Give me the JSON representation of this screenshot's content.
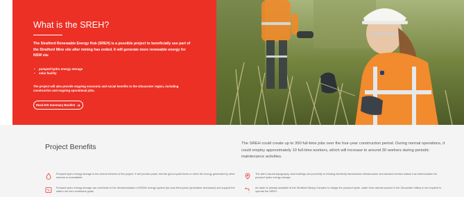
{
  "hero": {
    "title": "What is the SREH?",
    "intro": "The Stratford Renewable Energy Hub (SREH) is a possible project to beneficially use part of the Stratford Mine site after mining has ended. It will generate more renewable energy for NSW via:",
    "list": [
      "pumped hydro energy storage",
      "solar facility"
    ],
    "extra": "The project will also provide ongoing economic and social benefits to the Gloucester region, including construction and ongoing operational jobs.",
    "cta_label": "Read EIS Summary Booklet",
    "cta_icon": "arrow-right-icon",
    "accent_color": "#ec3025"
  },
  "benefits": {
    "title": "Project Benefits",
    "description": "The SREH could create up to 350 full-time jobs over the four-year construction period. During normal operations, it could employ approximately 10 full-time workers, which will increase to around 30 workers during periodic maintenance activities.",
    "items": [
      {
        "icon": "water-drop-icon",
        "text": "Pumped hydro energy storage is the central element of the project. It will provide power into the grid at peak times or when the energy generated by other sources is unavailable."
      },
      {
        "icon": "location-pin-icon",
        "text": "The site's natural topography, land holdings and proximity to existing electricity transmission infrastructure and demand centres makes it an ideal location for pumped hydro energy storage."
      },
      {
        "icon": "energy-system-icon",
        "text": "Pumped hydro energy storage can contribute to the decarbonisation of NSW's energy system (as coal-fired power generation decreases) and support the state's net zero emissions goals."
      },
      {
        "icon": "water-tap-icon",
        "text": "As water is already available at the Stratford Mining Complex to charge the pumped hydro, water from natural sources in the Gloucester Valley is not required to operate the SREH."
      }
    ],
    "icon_color": "#ec3025"
  }
}
